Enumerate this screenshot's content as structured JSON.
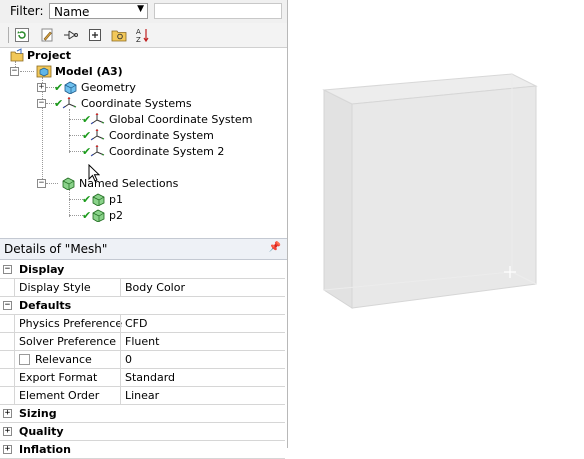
{
  "filter": {
    "label": "Filter:",
    "selected": "Name"
  },
  "toolbar": {
    "icons": [
      "refresh-icon",
      "edit-icon",
      "branch-icon",
      "expand-all-icon",
      "folder-icon",
      "sort-icon"
    ]
  },
  "tree": {
    "project": "Project",
    "model": "Model (A3)",
    "geometry": "Geometry",
    "coord_systems": "Coordinate Systems",
    "global_cs": "Global Coordinate System",
    "cs": "Coordinate System",
    "cs2": "Coordinate System 2",
    "named_selections": "Named Selections",
    "p1": "p1",
    "p2": "p2"
  },
  "details": {
    "title": "Details of \"Mesh\"",
    "rows": {
      "display": "Display",
      "display_style_k": "Display Style",
      "display_style_v": "Body Color",
      "defaults": "Defaults",
      "physics_k": "Physics Preference",
      "physics_v": "CFD",
      "solver_k": "Solver Preference",
      "solver_v": "Fluent",
      "relevance_k": "Relevance",
      "relevance_v": "0",
      "export_k": "Export Format",
      "export_v": "Standard",
      "order_k": "Element Order",
      "order_v": "Linear",
      "sizing": "Sizing",
      "quality": "Quality",
      "inflation": "Inflation"
    }
  },
  "colors": {
    "check": "#1a9a1a",
    "header_bg": "#eef1f6",
    "box_face": "#e6e6e6"
  }
}
